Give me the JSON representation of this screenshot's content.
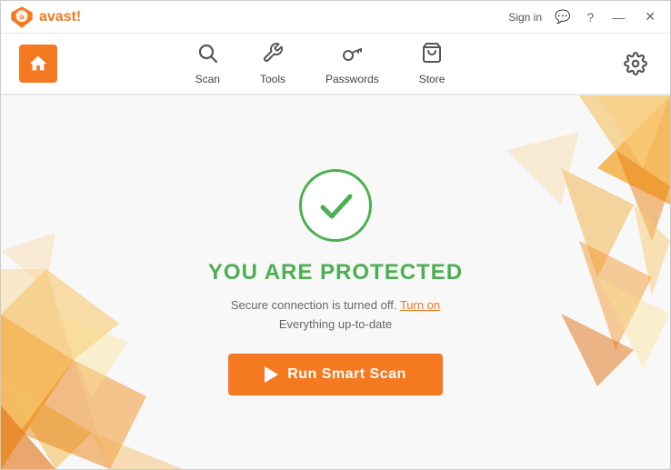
{
  "window": {
    "title": "avast!"
  },
  "titlebar": {
    "logo_text": "avast!",
    "signin_label": "Sign in",
    "chat_icon": "💬",
    "help_icon": "?",
    "minimize_icon": "—",
    "close_icon": "✕"
  },
  "navbar": {
    "home_label": "Home",
    "items": [
      {
        "id": "scan",
        "label": "Scan",
        "icon": "🔍"
      },
      {
        "id": "tools",
        "label": "Tools",
        "icon": "🔧"
      },
      {
        "id": "passwords",
        "label": "Passwords",
        "icon": "🔑"
      },
      {
        "id": "store",
        "label": "Store",
        "icon": "🛒"
      }
    ],
    "settings_icon": "⚙"
  },
  "main": {
    "status_title_prefix": "YOU ARE ",
    "status_title_highlight": "PROTECTED",
    "status_line1_prefix": "Secure connection is turned off.  ",
    "status_line1_link": "Turn on",
    "status_line2": "Everything up-to-date",
    "scan_button_label": "Run Smart Scan"
  },
  "colors": {
    "orange": "#f47920",
    "green": "#4caf50",
    "bg": "#f8f8f8"
  }
}
